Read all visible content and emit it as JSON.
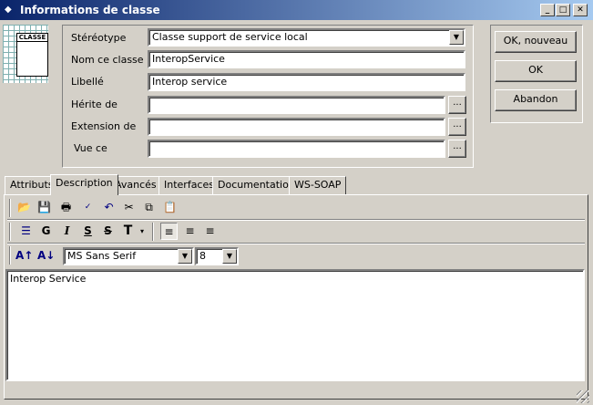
{
  "window": {
    "title": "Informations de classe"
  },
  "icon_label": "CLASSE",
  "form": {
    "stereotype_label": "Stéréotype",
    "stereotype_value": "Classe support de service local",
    "nom_label": "Nom ce classe",
    "nom_value": "InteropService",
    "libelle_label": "Libellé",
    "libelle_value": "Interop service",
    "herite_label": "Hérite de",
    "herite_value": "",
    "extension_label": "Extension de",
    "extension_value": "",
    "vue_label": "Vue ce",
    "vue_value": "",
    "browse_label": "..."
  },
  "buttons": {
    "ok_nouveau": "OK, nouveau",
    "ok": "OK",
    "abandon": "Abandon"
  },
  "tabs": [
    "Attributs",
    "Description",
    "Avancés",
    "Interfaces",
    "Documentation",
    "WS-SOAP"
  ],
  "active_tab": "Description",
  "format_bar": {
    "bold": "G",
    "italic": "I",
    "underline": "S",
    "strike": "S"
  },
  "font": {
    "name": "MS Sans Serif",
    "size": "8"
  },
  "editor_text": "Interop Service"
}
